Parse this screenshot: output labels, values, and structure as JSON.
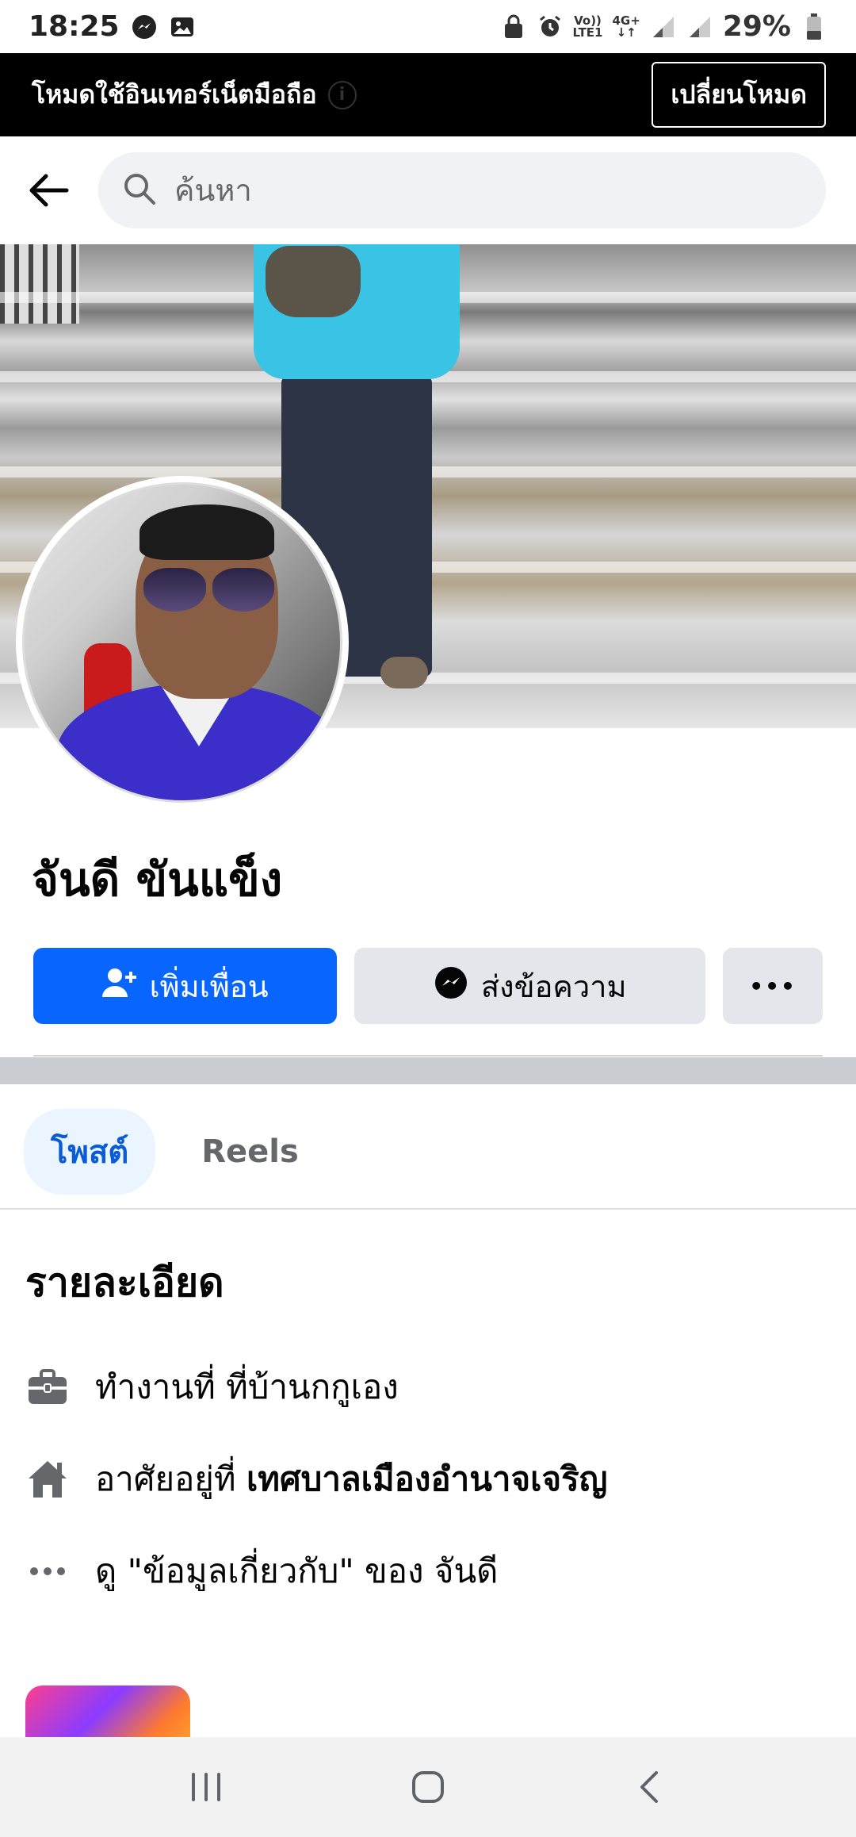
{
  "status_bar": {
    "time": "18:25",
    "network_top": "Vo))",
    "network_bottom": "LTE1",
    "data_top": "4G+",
    "data_bottom": "↓↑",
    "battery": "29%"
  },
  "banner": {
    "text": "โหมดใช้อินเทอร์เน็ตมือถือ",
    "info_icon": "i",
    "button_label": "เปลี่ยนโหมด"
  },
  "search": {
    "placeholder": "ค้นหา"
  },
  "profile": {
    "name": "จันดี ขันแข็ง"
  },
  "actions": {
    "add_friend": "เพิ่มเพื่อน",
    "message": "ส่งข้อความ",
    "more": "•••"
  },
  "tabs": [
    {
      "label": "โพสต์",
      "active": true
    },
    {
      "label": "Reels",
      "active": false
    }
  ],
  "details": {
    "title": "รายละเอียด",
    "work": "ทำงานที่ ที่บ้านกกูเอง",
    "lives_prefix": "อาศัยอยู่ที่ ",
    "lives_place": "เทศบาลเมืองอำนาจเจริญ",
    "about": "ดู \"ข้อมูลเกี่ยวกับ\" ของ จันดี"
  },
  "colors": {
    "primary": "#0866ff",
    "secondary_bg": "#e4e6eb",
    "active_tab_bg": "#ebf5ff",
    "active_tab_text": "#0a5bd6",
    "banner_bg": "#000000"
  }
}
